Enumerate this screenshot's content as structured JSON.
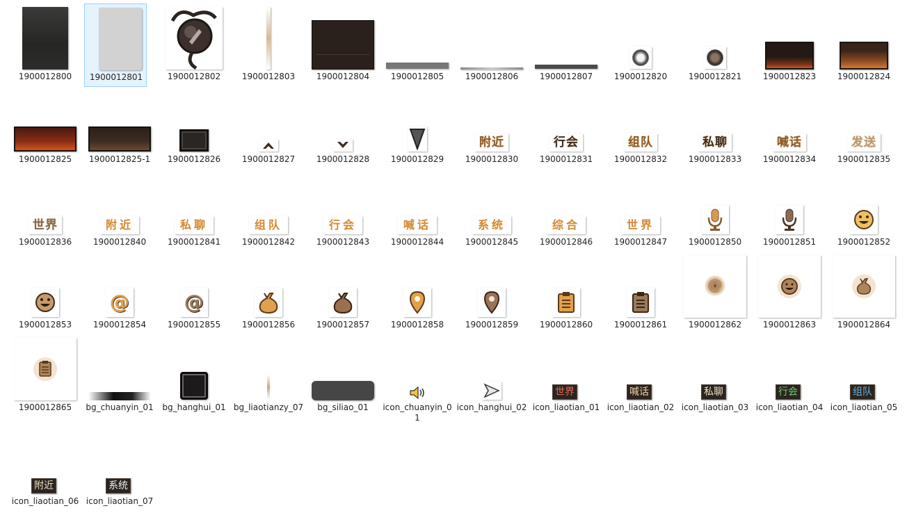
{
  "files": [
    {
      "label": "1900012800"
    },
    {
      "label": "1900012801"
    },
    {
      "label": "1900012802"
    },
    {
      "label": "1900012803"
    },
    {
      "label": "1900012804"
    },
    {
      "label": "1900012805"
    },
    {
      "label": "1900012806"
    },
    {
      "label": "1900012807"
    },
    {
      "label": "1900012820"
    },
    {
      "label": "1900012821"
    },
    {
      "label": "1900012823"
    },
    {
      "label": "1900012824"
    },
    {
      "label": "1900012825"
    },
    {
      "label": "1900012825-1"
    },
    {
      "label": "1900012826"
    },
    {
      "label": "1900012827"
    },
    {
      "label": "1900012828"
    },
    {
      "label": "1900012829"
    },
    {
      "label": "1900012830",
      "glyph": "附近"
    },
    {
      "label": "1900012831",
      "glyph": "行会"
    },
    {
      "label": "1900012832",
      "glyph": "组队"
    },
    {
      "label": "1900012833",
      "glyph": "私聊"
    },
    {
      "label": "1900012834",
      "glyph": "喊话"
    },
    {
      "label": "1900012835",
      "glyph": "发送"
    },
    {
      "label": "1900012836",
      "glyph": "世界"
    },
    {
      "label": "1900012840",
      "glyph": "附近"
    },
    {
      "label": "1900012841",
      "glyph": "私聊"
    },
    {
      "label": "1900012842",
      "glyph": "组队"
    },
    {
      "label": "1900012843",
      "glyph": "行会"
    },
    {
      "label": "1900012844",
      "glyph": "喊话"
    },
    {
      "label": "1900012845",
      "glyph": "系统"
    },
    {
      "label": "1900012846",
      "glyph": "综合"
    },
    {
      "label": "1900012847",
      "glyph": "世界"
    },
    {
      "label": "1900012850"
    },
    {
      "label": "1900012851"
    },
    {
      "label": "1900012852"
    },
    {
      "label": "1900012853"
    },
    {
      "label": "1900012854",
      "glyph": "@"
    },
    {
      "label": "1900012855",
      "glyph": "@"
    },
    {
      "label": "1900012856"
    },
    {
      "label": "1900012857"
    },
    {
      "label": "1900012858"
    },
    {
      "label": "1900012859"
    },
    {
      "label": "1900012860"
    },
    {
      "label": "1900012861"
    },
    {
      "label": "1900012862",
      "glyph": "@"
    },
    {
      "label": "1900012863"
    },
    {
      "label": "1900012864"
    },
    {
      "label": "1900012865"
    },
    {
      "label": "bg_chuanyin_01"
    },
    {
      "label": "bg_hanghui_01"
    },
    {
      "label": "bg_liaotianzy_07"
    },
    {
      "label": "bg_siliao_01"
    },
    {
      "label": "icon_chuanyin_01"
    },
    {
      "label": "icon_hanghui_02"
    },
    {
      "label": "icon_liaotian_01",
      "glyph": "世界"
    },
    {
      "label": "icon_liaotian_02",
      "glyph": "喊话"
    },
    {
      "label": "icon_liaotian_03",
      "glyph": "私聊"
    },
    {
      "label": "icon_liaotian_04",
      "glyph": "行会"
    },
    {
      "label": "icon_liaotian_05",
      "glyph": "组队"
    },
    {
      "label": "icon_liaotian_06",
      "glyph": "附近"
    },
    {
      "label": "icon_liaotian_07",
      "glyph": "系统"
    }
  ],
  "selected": "1900012801",
  "colors": {
    "selection_border": "#99d1ff",
    "selection_fill": "#e5f3ff",
    "gold_text": "#8a5a2b",
    "tag_bg": "#2b2520"
  }
}
